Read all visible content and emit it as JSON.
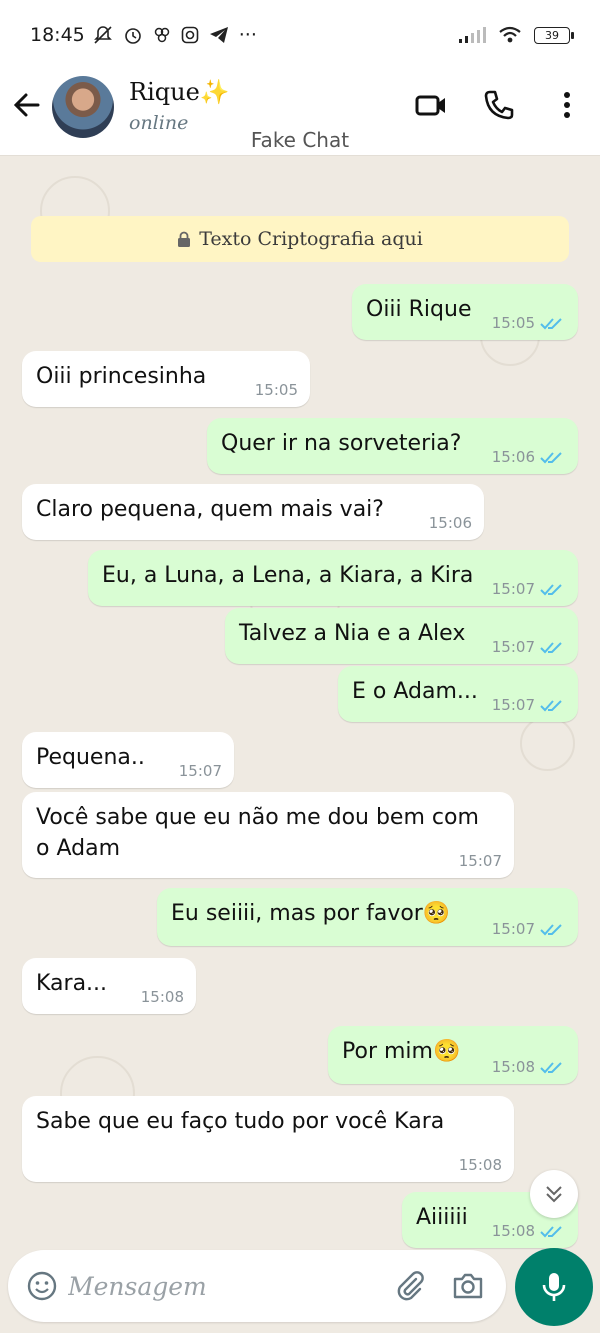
{
  "status_bar": {
    "time": "18:45",
    "icons": [
      "mute-icon",
      "alarm-icon",
      "app-icon",
      "instagram-icon",
      "telegram-icon"
    ],
    "more": "···",
    "battery": "39"
  },
  "header": {
    "contact_name": "Rique✨",
    "contact_status": "online",
    "subtitle": "Fake Chat"
  },
  "encryption_banner": "Texto Criptografia aqui",
  "messages": [
    {
      "dir": "out",
      "text": "Oiii Rique",
      "time": "15:05"
    },
    {
      "dir": "in",
      "text": "Oiii princesinha",
      "time": "15:05"
    },
    {
      "dir": "out",
      "text": "Quer ir na sorveteria?",
      "time": "15:06"
    },
    {
      "dir": "in",
      "text": "Claro pequena, quem mais vai?",
      "time": "15:06"
    },
    {
      "dir": "out",
      "text": "Eu, a Luna, a Lena, a Kiara, a Kira",
      "time": "15:07"
    },
    {
      "dir": "out",
      "text": "Talvez a Nia e a Alex",
      "time": "15:07"
    },
    {
      "dir": "out",
      "text": "E o Adam...",
      "time": "15:07"
    },
    {
      "dir": "in",
      "text": "Pequena..",
      "time": "15:07"
    },
    {
      "dir": "in",
      "text": "Você sabe que eu não me dou bem com o Adam",
      "time": "15:07"
    },
    {
      "dir": "out",
      "text": "Eu seiiii, mas por favor🥺",
      "time": "15:07"
    },
    {
      "dir": "in",
      "text": "Kara...",
      "time": "15:08"
    },
    {
      "dir": "out",
      "text": "Por mim🥺",
      "time": "15:08"
    },
    {
      "dir": "in",
      "text": "Sabe que eu faço tudo por você Kara",
      "time": "15:08"
    },
    {
      "dir": "out",
      "text": "Aiiiiii",
      "time": "15:08"
    }
  ],
  "composer": {
    "placeholder": "Mensagem"
  },
  "colors": {
    "outgoing_bubble": "#d9fdd3",
    "incoming_bubble": "#ffffff",
    "chat_bg": "#efeae2",
    "read_ticks": "#53bdeb",
    "mic_button": "#00806b",
    "banner": "#fff5c4"
  }
}
